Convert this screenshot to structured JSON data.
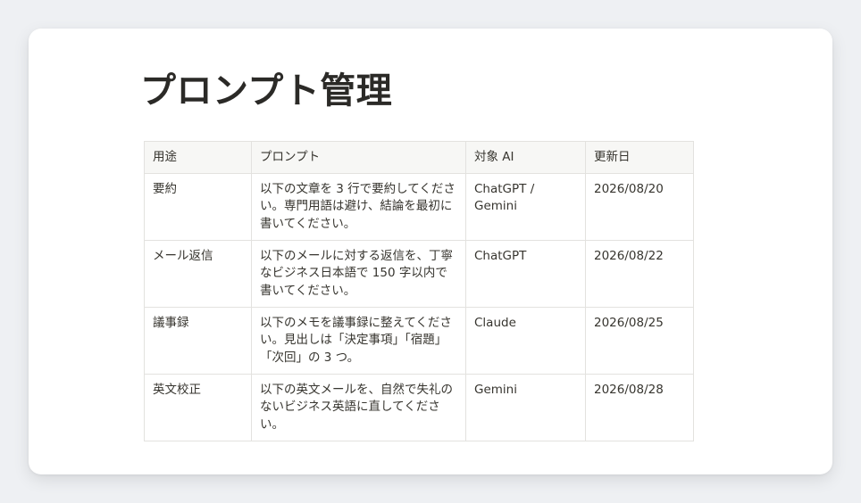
{
  "page": {
    "title": "プロンプト管理"
  },
  "table": {
    "columns": [
      "用途",
      "プロンプト",
      "対象 AI",
      "更新日"
    ],
    "rows": [
      {
        "purpose": "要約",
        "prompt": "以下の文章を 3 行で要約してください。専門用語は避け、結論を最初に書いてください。",
        "target_ai": "ChatGPT / Gemini",
        "updated": "2026/08/20"
      },
      {
        "purpose": "メール返信",
        "prompt": "以下のメールに対する返信を、丁寧なビジネス日本語で 150 字以内で書いてください。",
        "target_ai": "ChatGPT",
        "updated": "2026/08/22"
      },
      {
        "purpose": "議事録",
        "prompt": "以下のメモを議事録に整えてください。見出しは「決定事項」「宿題」「次回」の 3 つ。",
        "target_ai": "Claude",
        "updated": "2026/08/25"
      },
      {
        "purpose": "英文校正",
        "prompt": "以下の英文メールを、自然で失礼のないビジネス英語に直してください。",
        "target_ai": "Gemini",
        "updated": "2026/08/28"
      }
    ]
  }
}
